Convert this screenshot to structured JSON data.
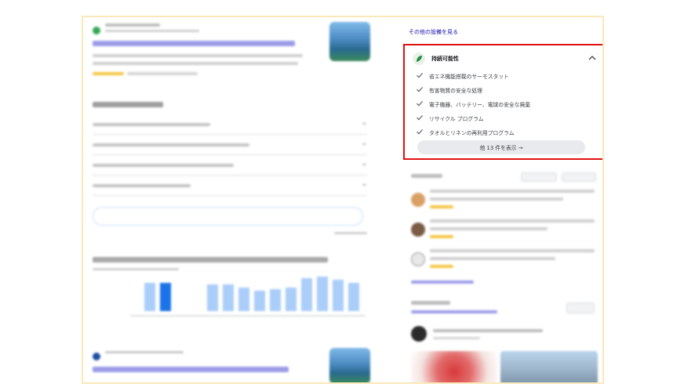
{
  "right_panel": {
    "other_features_link": "その他の設備を見る",
    "sustainability": {
      "title": "持続可能性",
      "items": [
        "省エネ機能搭載のサーモスタット",
        "有害物質の安全な処理",
        "電子機器、バッテリー、電球の安全な廃棄",
        "リサイクル プログラム",
        "タオルとリネンの再利用プログラム"
      ],
      "more_button": "他 13 件を表示"
    }
  },
  "icons": {
    "leaf": "leaf-icon",
    "chevron": "chevron-up-icon",
    "check": "check-icon",
    "arrow": "arrow-right-icon"
  },
  "colors": {
    "highlight_border": "#e01010",
    "frame_border": "#fbe8b8",
    "link": "#1a0dab",
    "leaf_green": "#1e8e3e"
  }
}
